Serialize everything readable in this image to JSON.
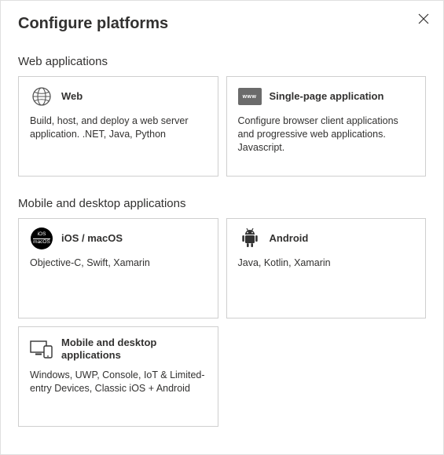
{
  "title": "Configure platforms",
  "sections": {
    "web": {
      "heading": "Web applications",
      "cards": {
        "web": {
          "title": "Web",
          "desc": "Build, host, and deploy a web server application. .NET, Java, Python"
        },
        "spa": {
          "title": "Single-page application",
          "desc": "Configure browser client applications and progressive web applications. Javascript.",
          "badge": "www"
        }
      }
    },
    "mobile": {
      "heading": "Mobile and desktop applications",
      "cards": {
        "ios": {
          "title": "iOS / macOS",
          "desc": "Objective-C, Swift, Xamarin",
          "line1": "iOS",
          "line2": "macOS"
        },
        "android": {
          "title": "Android",
          "desc": "Java, Kotlin, Xamarin"
        },
        "desktop": {
          "title": "Mobile and desktop applications",
          "desc": "Windows, UWP, Console, IoT & Limited-entry Devices, Classic iOS + Android"
        }
      }
    }
  }
}
